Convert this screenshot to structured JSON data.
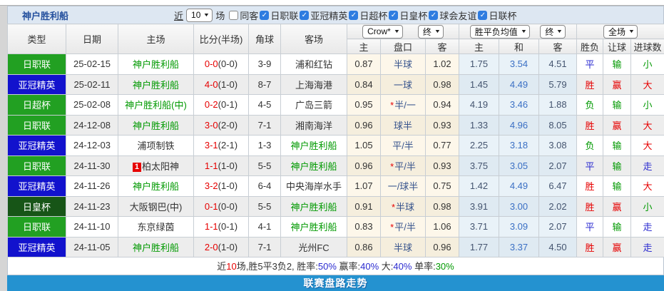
{
  "header": {
    "team_title": "神户胜利船",
    "recent_label": "近",
    "recent_count": "10",
    "matches_label": "场",
    "checkboxes": [
      {
        "label": "同客",
        "checked": false
      },
      {
        "label": "日职联",
        "checked": true
      },
      {
        "label": "亚冠精英",
        "checked": true
      },
      {
        "label": "日超杯",
        "checked": true
      },
      {
        "label": "日皇杯",
        "checked": true
      },
      {
        "label": "球会友谊",
        "checked": true
      },
      {
        "label": "日联杯",
        "checked": true
      }
    ]
  },
  "controls": {
    "company_select": "Crow*",
    "company_time_select": "终",
    "europe_select": "胜平负均值",
    "europe_time_select": "终",
    "scope_select": "全场"
  },
  "table": {
    "main_headers": [
      "类型",
      "日期",
      "主场",
      "比分(半场)",
      "角球",
      "客场"
    ],
    "sub_headers": [
      "主",
      "盘口",
      "客",
      "主",
      "和",
      "客",
      "胜负",
      "让球",
      "进球数"
    ],
    "rows": [
      {
        "league": "日职联",
        "league_color": "green",
        "date": "25-02-15",
        "home": "神户胜利船",
        "home_is_team": true,
        "home_red_card": null,
        "score": "0-0",
        "half": "(0-0)",
        "corner": "3-9",
        "away": "浦和红钻",
        "away_is_team": false,
        "crow_home": "0.87",
        "handicap": "半球",
        "handicap_star": false,
        "crow_away": "1.02",
        "avg_home": "1.75",
        "avg_draw": "3.54",
        "avg_away": "4.51",
        "result": "平",
        "result_color": "blue",
        "asian": "输",
        "asian_color": "green",
        "goals": "小",
        "goals_color": "green"
      },
      {
        "league": "亚冠精英",
        "league_color": "blue",
        "date": "25-02-11",
        "home": "神户胜利船",
        "home_is_team": true,
        "home_red_card": null,
        "score": "4-0",
        "half": "(1-0)",
        "corner": "8-7",
        "away": "上海海港",
        "away_is_team": false,
        "crow_home": "0.84",
        "handicap": "一球",
        "handicap_star": false,
        "crow_away": "0.98",
        "avg_home": "1.45",
        "avg_draw": "4.49",
        "avg_away": "5.79",
        "result": "胜",
        "result_color": "red",
        "asian": "赢",
        "asian_color": "red",
        "goals": "大",
        "goals_color": "red"
      },
      {
        "league": "日超杯",
        "league_color": "green",
        "date": "25-02-08",
        "home": "神户胜利船(中)",
        "home_is_team": true,
        "home_red_card": null,
        "score": "0-2",
        "half": "(0-1)",
        "corner": "4-5",
        "away": "广岛三箭",
        "away_is_team": false,
        "crow_home": "0.95",
        "handicap": "半/一",
        "handicap_star": true,
        "crow_away": "0.94",
        "avg_home": "4.19",
        "avg_draw": "3.46",
        "avg_away": "1.88",
        "result": "负",
        "result_color": "green",
        "asian": "输",
        "asian_color": "green",
        "goals": "小",
        "goals_color": "green"
      },
      {
        "league": "日职联",
        "league_color": "green",
        "date": "24-12-08",
        "home": "神户胜利船",
        "home_is_team": true,
        "home_red_card": null,
        "score": "3-0",
        "half": "(2-0)",
        "corner": "7-1",
        "away": "湘南海洋",
        "away_is_team": false,
        "crow_home": "0.96",
        "handicap": "球半",
        "handicap_star": false,
        "crow_away": "0.93",
        "avg_home": "1.33",
        "avg_draw": "4.96",
        "avg_away": "8.05",
        "result": "胜",
        "result_color": "red",
        "asian": "赢",
        "asian_color": "red",
        "goals": "大",
        "goals_color": "red"
      },
      {
        "league": "亚冠精英",
        "league_color": "blue",
        "date": "24-12-03",
        "home": "浦项制铁",
        "home_is_team": false,
        "home_red_card": null,
        "score": "3-1",
        "half": "(2-1)",
        "corner": "1-3",
        "away": "神户胜利船",
        "away_is_team": true,
        "crow_home": "1.05",
        "handicap": "平/半",
        "handicap_star": false,
        "crow_away": "0.77",
        "avg_home": "2.25",
        "avg_draw": "3.18",
        "avg_away": "3.08",
        "result": "负",
        "result_color": "green",
        "asian": "输",
        "asian_color": "green",
        "goals": "大",
        "goals_color": "red"
      },
      {
        "league": "日职联",
        "league_color": "green",
        "date": "24-11-30",
        "home": "柏太阳神",
        "home_is_team": false,
        "home_red_card": "1",
        "score": "1-1",
        "half": "(1-0)",
        "corner": "5-5",
        "away": "神户胜利船",
        "away_is_team": true,
        "crow_home": "0.96",
        "handicap": "平/半",
        "handicap_star": true,
        "crow_away": "0.93",
        "avg_home": "3.75",
        "avg_draw": "3.05",
        "avg_away": "2.07",
        "result": "平",
        "result_color": "blue",
        "asian": "输",
        "asian_color": "green",
        "goals": "走",
        "goals_color": "blue"
      },
      {
        "league": "亚冠精英",
        "league_color": "blue",
        "date": "24-11-26",
        "home": "神户胜利船",
        "home_is_team": true,
        "home_red_card": null,
        "score": "3-2",
        "half": "(1-0)",
        "corner": "6-4",
        "away": "中央海岸水手",
        "away_is_team": false,
        "crow_home": "1.07",
        "handicap": "一/球半",
        "handicap_star": false,
        "crow_away": "0.75",
        "avg_home": "1.42",
        "avg_draw": "4.49",
        "avg_away": "6.47",
        "result": "胜",
        "result_color": "red",
        "asian": "输",
        "asian_color": "green",
        "goals": "大",
        "goals_color": "red"
      },
      {
        "league": "日皇杯",
        "league_color": "darkgreen",
        "date": "24-11-23",
        "home": "大阪钢巴(中)",
        "home_is_team": false,
        "home_red_card": null,
        "score": "0-1",
        "half": "(0-0)",
        "corner": "5-5",
        "away": "神户胜利船",
        "away_is_team": true,
        "crow_home": "0.91",
        "handicap": "半球",
        "handicap_star": true,
        "crow_away": "0.98",
        "avg_home": "3.91",
        "avg_draw": "3.00",
        "avg_away": "2.02",
        "result": "胜",
        "result_color": "red",
        "asian": "赢",
        "asian_color": "red",
        "goals": "小",
        "goals_color": "green"
      },
      {
        "league": "日职联",
        "league_color": "green",
        "date": "24-11-10",
        "home": "东京绿茵",
        "home_is_team": false,
        "home_red_card": null,
        "score": "1-1",
        "half": "(0-1)",
        "corner": "4-1",
        "away": "神户胜利船",
        "away_is_team": true,
        "crow_home": "0.83",
        "handicap": "平/半",
        "handicap_star": true,
        "crow_away": "1.06",
        "avg_home": "3.71",
        "avg_draw": "3.09",
        "avg_away": "2.07",
        "result": "平",
        "result_color": "blue",
        "asian": "输",
        "asian_color": "green",
        "goals": "走",
        "goals_color": "blue"
      },
      {
        "league": "亚冠精英",
        "league_color": "blue",
        "date": "24-11-05",
        "home": "神户胜利船",
        "home_is_team": true,
        "home_red_card": null,
        "score": "2-0",
        "half": "(1-0)",
        "corner": "7-1",
        "away": "光州FC",
        "away_is_team": false,
        "crow_home": "0.86",
        "handicap": "半球",
        "handicap_star": false,
        "crow_away": "0.96",
        "avg_home": "1.77",
        "avg_draw": "3.37",
        "avg_away": "4.50",
        "result": "胜",
        "result_color": "red",
        "asian": "赢",
        "asian_color": "red",
        "goals": "走",
        "goals_color": "blue"
      }
    ]
  },
  "summary": {
    "segments": [
      {
        "text": "近",
        "color": "dark"
      },
      {
        "text": "10",
        "color": "red"
      },
      {
        "text": "场,胜5平3负2, 胜率:",
        "color": "dark"
      },
      {
        "text": "50%",
        "color": "blue"
      },
      {
        "text": " 赢率:",
        "color": "dark"
      },
      {
        "text": "40%",
        "color": "blue"
      },
      {
        "text": " 大:",
        "color": "dark"
      },
      {
        "text": "40%",
        "color": "blue"
      },
      {
        "text": " 单率:",
        "color": "dark"
      },
      {
        "text": "30%",
        "color": "green"
      }
    ]
  },
  "footer": {
    "label": "联赛盘路走势"
  },
  "colors": {
    "league_green": "#22a022",
    "league_blue": "#1212cd",
    "league_darkgreen": "#175517",
    "footer_bar_blue": "#2492d0",
    "title_bar_bg": "#dde7f2",
    "team_name_green": "#009900",
    "score_red": "#e60000"
  }
}
